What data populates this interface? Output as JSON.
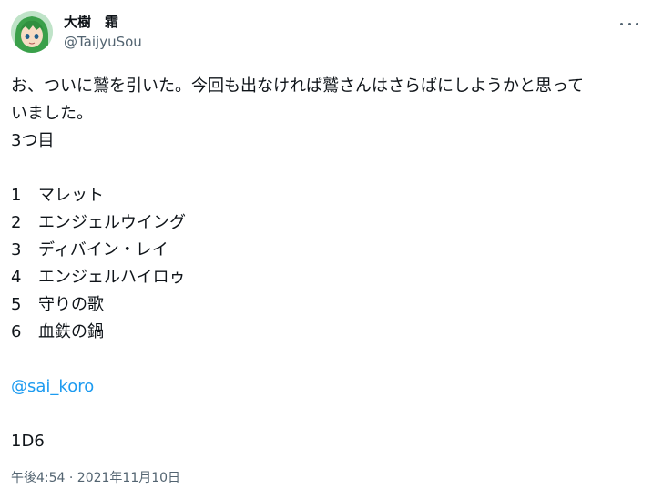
{
  "author": {
    "display_name": "大樹　霜",
    "handle": "@TaijyuSou"
  },
  "tweet": {
    "line1": "お、ついに鷲を引いた。今回も出なければ鷲さんはさらばにしようかと思って",
    "line2": "いました。",
    "line3": "3つ目",
    "list": [
      {
        "num": "1",
        "text": "マレット"
      },
      {
        "num": "2",
        "text": "エンジェルウイング"
      },
      {
        "num": "3",
        "text": "ディバイン・レイ"
      },
      {
        "num": "4",
        "text": "エンジェルハイロゥ"
      },
      {
        "num": "5",
        "text": "守りの歌"
      },
      {
        "num": "6",
        "text": "血鉄の鍋"
      }
    ],
    "mention": "@sai_koro",
    "dice": "1D6"
  },
  "timestamp": "午後4:54 · 2021年11月10日",
  "icons": {
    "more": "more-horizontal-icon",
    "avatar": "avatar-image"
  }
}
